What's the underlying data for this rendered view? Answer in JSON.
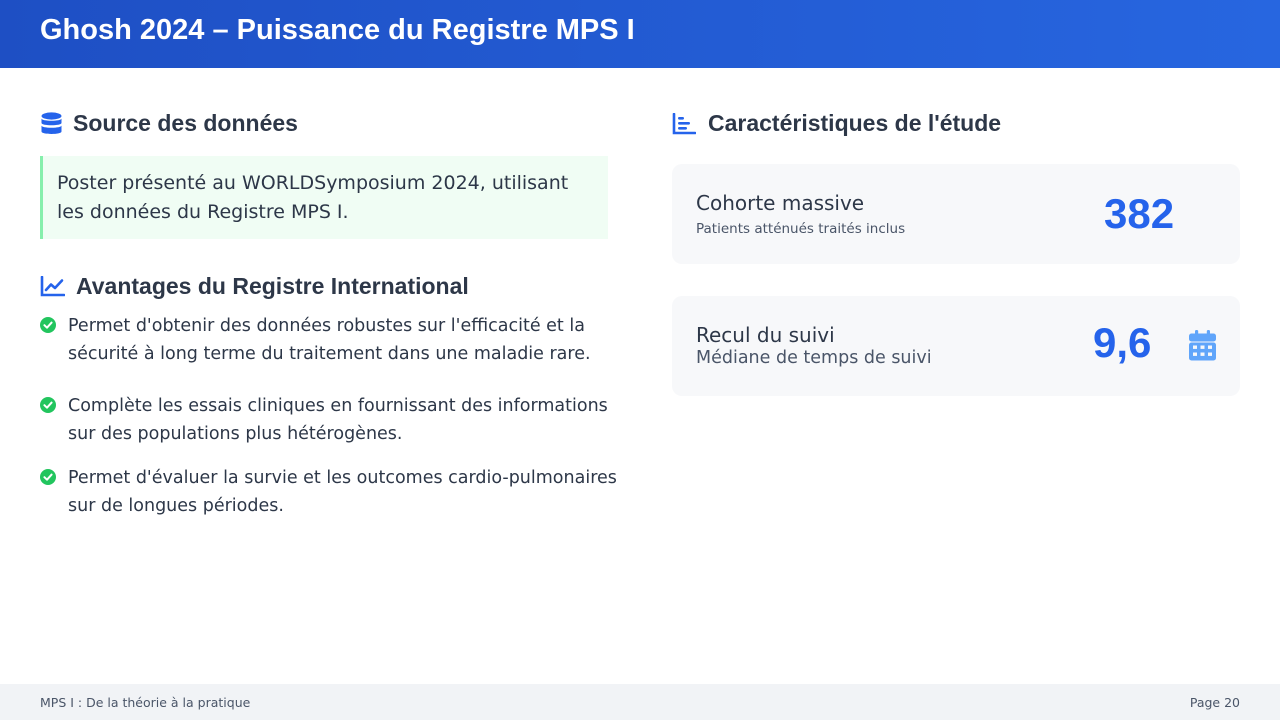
{
  "header": {
    "title": "Ghosh 2024 – Puissance du Registre MPS I"
  },
  "source": {
    "heading": "Source des données",
    "text": "Poster présenté au WORLDSymposium 2024, utilisant les données du Registre MPS I."
  },
  "advantages": {
    "heading": "Avantages du Registre International",
    "items": [
      "Permet d'obtenir des données robustes sur l'efficacité et la sécurité à long terme du traitement dans une maladie rare.",
      "Complète les essais cliniques en fournissant des informations sur des populations plus hétérogènes.",
      "Permet d'évaluer la survie et les outcomes cardio-pulmonaires sur de longues périodes."
    ]
  },
  "characteristics": {
    "heading": "Caractéristiques de l'étude",
    "cards": [
      {
        "title": "Cohorte massive",
        "subtitle": "Patients atténués traités inclus",
        "value": "382"
      },
      {
        "title": "Recul du suivi",
        "subtitle": "Médiane de temps de suivi",
        "value": "9,6"
      }
    ]
  },
  "footer": {
    "left": "MPS I : De la théorie à la pratique",
    "right": "Page 20"
  },
  "colors": {
    "accent": "#2563eb",
    "header_start": "#1e4fc4",
    "header_end": "#2766e0",
    "check": "#22c55e",
    "source_bg": "#f0fdf4",
    "source_border": "#86efac"
  },
  "icons": {
    "source": "database-icon",
    "advantages": "chart-line-icon",
    "characteristics": "chart-bar-icon",
    "check": "check-circle-icon",
    "calendar": "calendar-icon"
  }
}
